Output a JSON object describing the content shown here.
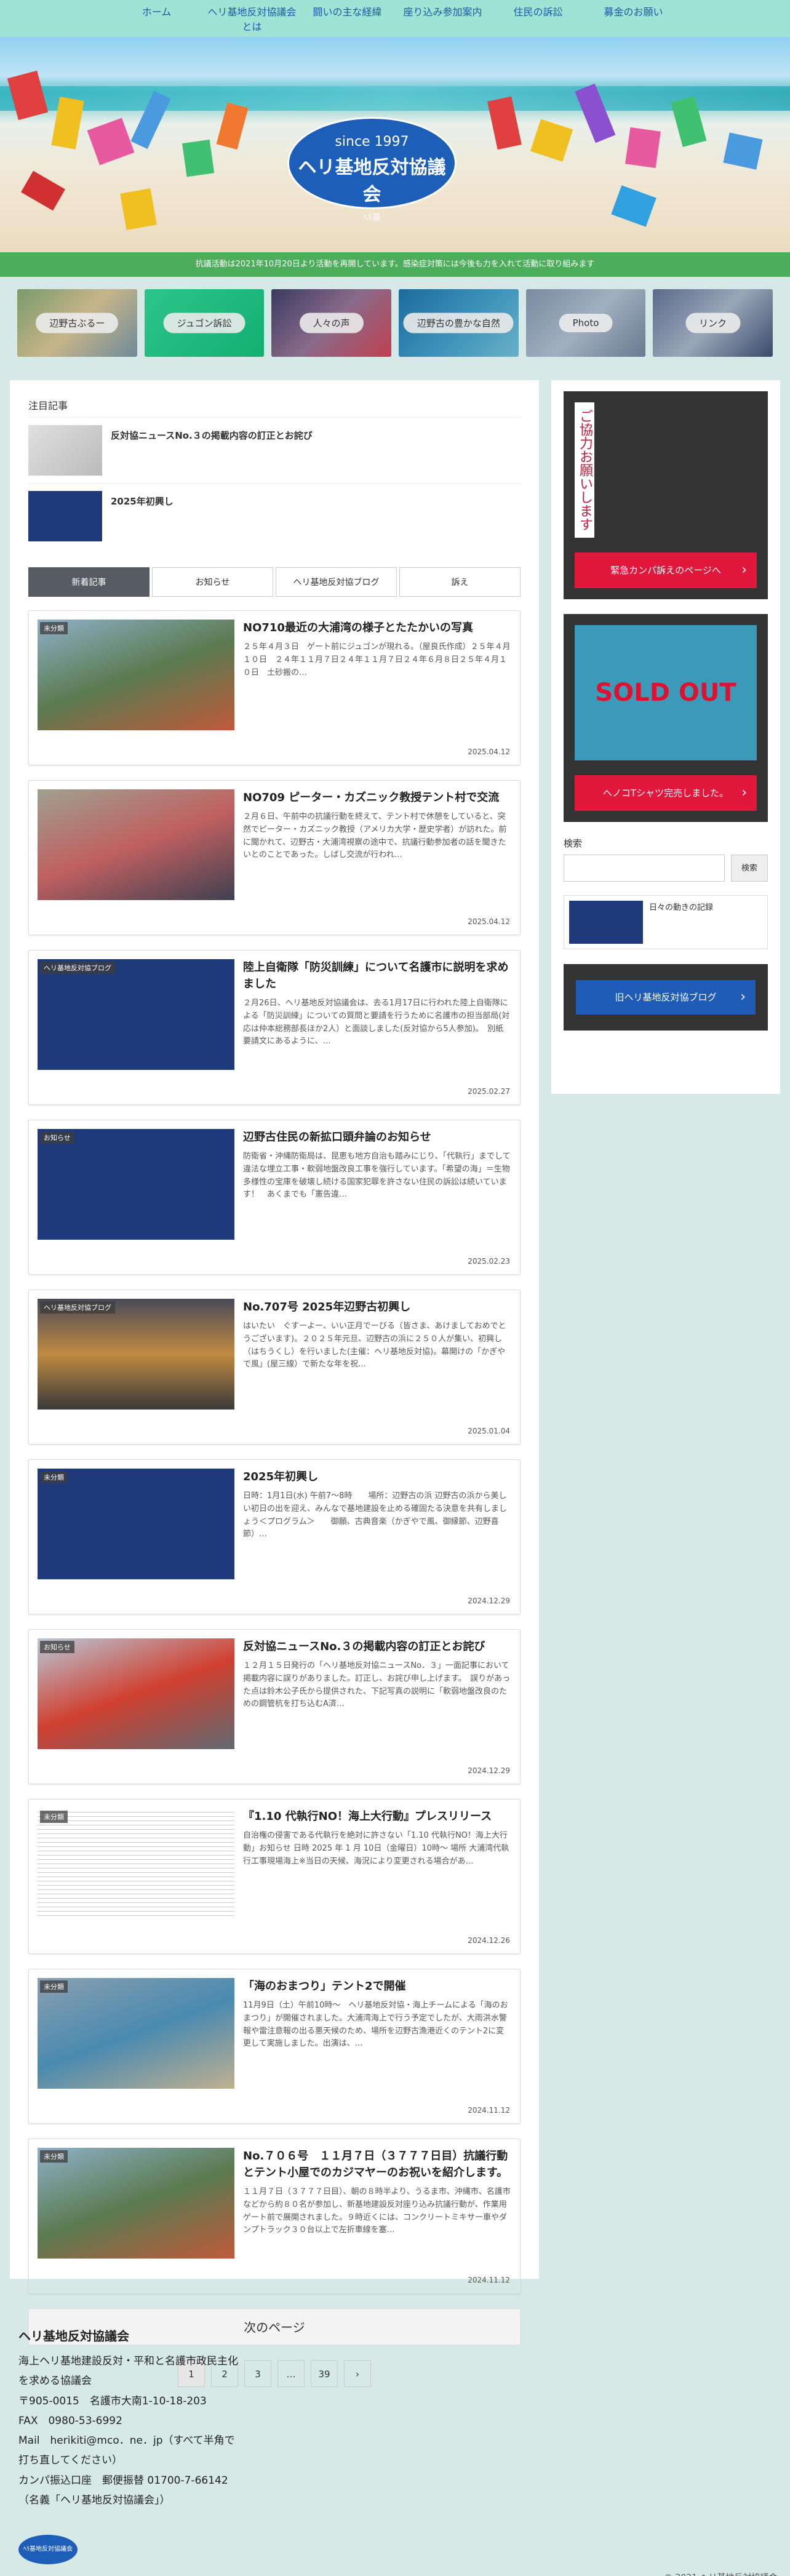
{
  "nav": [
    "ホーム",
    "ヘリ基地反対協議会とは",
    "闘いの主な経緯",
    "座り込み参加案内",
    "住民の訴訟",
    "募金のお願い"
  ],
  "hero": {
    "since": "since 1997",
    "name": "ヘリ基地反対協議会",
    "mini": "ﾍﾘ基"
  },
  "notice": "抗議活動は2021年10月20日より活動を再開しています。感染症対策には今後も力を入れて活動に取り組みます",
  "tiles": [
    "辺野古ぶるー",
    "ジュゴン訴訟",
    "人々の声",
    "辺野古の豊かな自然",
    "Photo",
    "リンク"
  ],
  "featured": {
    "heading": "注目記事",
    "items": [
      "反対協ニュースNo.３の掲載内容の訂正とお詫び",
      "2025年初興し"
    ]
  },
  "tabs": [
    "新着記事",
    "お知らせ",
    "ヘリ基地反対協ブログ",
    "訴え"
  ],
  "posts": [
    {
      "cat": "未分類",
      "title": "NO710最近の大浦湾の様子とたたかいの写真",
      "excerpt": "２５年４月３日　ゲート前にジュゴンが現れる。（屋良氏作成）２５年４月１０日　２４年１１月７日２４年１１月７日２４年６月８日２５年４月１０日　土砂搬の…",
      "date": "2025.04.12"
    },
    {
      "cat": "",
      "title": "NO709 ピーター・カズニック教授テント村で交流",
      "excerpt": "２月６日、午前中の抗議行動を終えて、テント村で休憩をしていると、突然でピーター・カズニック教授（アメリカ大学・歴史学者）が訪れた。前に聞かれて、辺野古・大浦湾視察の途中で、抗議行動参加者の話を聞きたいとのことであった。しばし交流が行われ…",
      "date": "2025.04.12"
    },
    {
      "cat": "ヘリ基地反対協ブログ",
      "title": "陸上自衛隊「防災訓練」について名護市に説明を求めました",
      "excerpt": "２月26日、ヘリ基地反対協議会は、去る1月17日に行われた陸上自衛隊による「防災訓練」についての質問と要請を行うために名護市の担当部局(対応は仲本総務部長ほか2人）と面談しました(反対協から5人参加)。　別紙要請文にあるように、…",
      "date": "2025.02.27"
    },
    {
      "cat": "お知らせ",
      "title": "辺野古住民の新拡口頭弁論のお知らせ",
      "excerpt": "防衛省・沖縄防衛局は、昆恵も地方自治も踏みにじり、「代執行」までして違法な埋立工事・軟弱地盤改良工事を強行しています。「希望の海」＝生物多様性の宝庫を破壊し続ける国家犯罪を許さない住民の訴訟は続いています！　あくまでも「憲告違…",
      "date": "2025.02.23"
    },
    {
      "cat": "ヘリ基地反対協ブログ",
      "title": "No.707号 2025年辺野古初興し",
      "excerpt": "はいたい　ぐすーよー、いい正月でーびる（皆さま、あけましておめでとうございます)。２０２５年元旦、辺野古の浜に２５０人が集い、初興し（はちうくし）を行いました(主催：ヘリ基地反対協)。幕開けの「かぎやで風」(屋三線）で新たな年を祝…",
      "date": "2025.01.04"
    },
    {
      "cat": "未分類",
      "title": "2025年初興し",
      "excerpt": "日時：1月1日(水) 午前7～8時　　場所：辺野古の浜 辺野古の浜から美しい初日の出を迎え、みんなで基地建設を止める確固たる決意を共有しましょう＜プログラム＞　　御願、古典音楽（かぎやで風、御縁節、辺野喜節）…",
      "date": "2024.12.29"
    },
    {
      "cat": "お知らせ",
      "title": "反対協ニュースNo.３の掲載内容の訂正とお詫び",
      "excerpt": "１２月１５日発行の「ヘリ基地反対協ニュースNo．３」一面記事において掲載内容に誤りがありました。訂正し、お詫び申し上げます。　誤りがあった点は鈴木公子氏から提供された、下記写真の説明に「軟弱地盤改良のための鋼管杭を打ち込むA済…",
      "date": "2024.12.29"
    },
    {
      "cat": "未分類",
      "title": "『1.10 代執行NO！海上大行動』プレスリリース",
      "excerpt": "自治権の侵害である代執行を絶対に許さない「1.10 代執行NO！海上大行動」お知らせ 日時 2025 年 1 月 10日（金曜日）10時～ 場所 大浦湾代執行工事現場海上※当日の天候、海況により変更される場合があ…",
      "date": "2024.12.26"
    },
    {
      "cat": "未分類",
      "title": "「海のおまつり」テント2で開催",
      "excerpt": "11月9日（土）午前10時～　ヘリ基地反対協・海上チームによる「海のおまつり」が開催されました。大浦湾海上で行う予定でしたが、大雨洪水警報や雷注意報の出る悪天候のため、場所を辺野古漁港近くのテント2に変更して実施しました。出演は、…",
      "date": "2024.11.12"
    },
    {
      "cat": "未分類",
      "title": "No.７０６号　１１月７日（３７７７日目）抗議行動とテント小屋でのカジマヤーのお祝いを紹介します。",
      "excerpt": "１１月７日（３７７７日目）、朝の８時半より、うるま市、沖縄市、名護市などから約８０名が参加し、新基地建設反対座り込み抗議行動が、作業用ゲート前で展開されました。９時近くには、コンクリートミキサー車やダンプトラック３０台以上で左折車線を塞…",
      "date": "2024.11.12"
    }
  ],
  "next_label": "次のページ",
  "pager": [
    "1",
    "2",
    "3",
    "…",
    "39",
    "›"
  ],
  "sidebar": {
    "banner1_text": "ご協力お願いします",
    "banner1_btn": "緊急カンパ訴えのページへ",
    "banner2_text": "SOLD OUT",
    "banner2_btn": "ヘノコTシャツ完売しました。",
    "search_label": "検索",
    "search_btn": "検索",
    "side_post": "日々の動きの記録",
    "blog_btn": "旧ヘリ基地反対協ブログ"
  },
  "footer": {
    "org": "ヘリ基地反対協議会",
    "lines": [
      "海上ヘリ基地建設反対・平和と名護市政民主化",
      "を求める協議会",
      "〒905-0015　名護市大南1-10-18-203",
      "FAX　0980-53-6992",
      "Mail　herikiti@mco．ne．jp（すべて半角で",
      "打ち直してください）",
      "カンパ振込口座　郵便振替 01700-7-66142",
      "（名義「ヘリ基地反対協議会」）"
    ],
    "copy": "© 2021 ヘリ基地反対協議会."
  }
}
